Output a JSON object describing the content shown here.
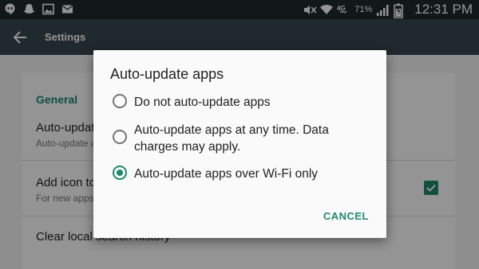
{
  "status_bar": {
    "battery_percent": "71%",
    "time": "12:31 PM",
    "left_icons": [
      "hangouts-icon",
      "snapchat-icon",
      "gallery-icon",
      "email-icon"
    ],
    "right_icons": [
      "mute-icon",
      "wifi-icon",
      "lte-icon",
      "signal-icon",
      "battery-icon"
    ]
  },
  "app_bar": {
    "title": "Settings"
  },
  "settings": {
    "section_general": "General",
    "pref_auto_update_title": "Auto-update apps",
    "pref_auto_update_sub": "Auto-update apps over Wi-Fi only",
    "pref_add_icon_title": "Add icon to Home screen",
    "pref_add_icon_sub": "For new apps",
    "pref_add_icon_checked": true,
    "pref_clear_history_title": "Clear local search history"
  },
  "dialog": {
    "title": "Auto-update apps",
    "options": [
      {
        "label": "Do not auto-update apps",
        "selected": false
      },
      {
        "label": "Auto-update apps at any time. Data charges may apply.",
        "selected": false
      },
      {
        "label": "Auto-update apps over Wi-Fi only",
        "selected": true
      }
    ],
    "cancel_label": "CANCEL"
  },
  "colors": {
    "accent": "#1e8a6b",
    "app_bar": "#37474f",
    "status_bar": "#1f2a2a"
  }
}
